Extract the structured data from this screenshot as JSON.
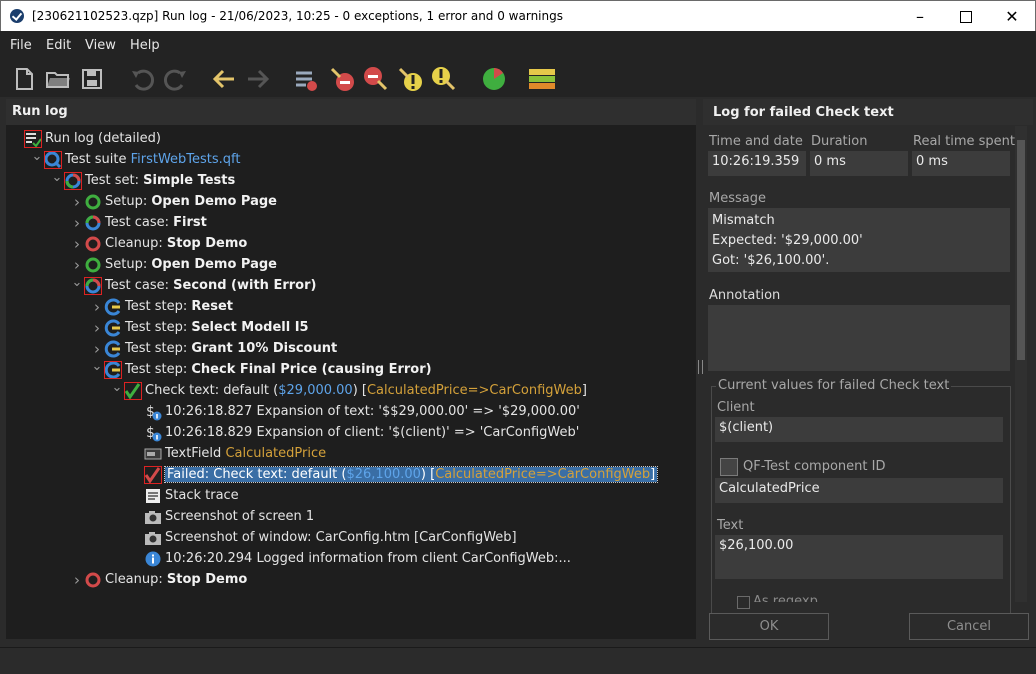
{
  "window": {
    "title": "[230621102523.qzp] Run log - 21/06/2023, 10:25 - 0 exceptions, 1 error and 0 warnings"
  },
  "menu": [
    "File",
    "Edit",
    "View",
    "Help"
  ],
  "toolbar": [
    "new-file",
    "open-folder",
    "save",
    "undo",
    "redo",
    "back-arrow",
    "forward-arrow",
    "collapse-errors",
    "prev-error",
    "next-error",
    "prev-warning",
    "next-warning",
    "pie-chart",
    "bar-chart"
  ],
  "left": {
    "header": "Run log",
    "tree": [
      {
        "indent": 0,
        "chev": "",
        "icon": "log",
        "prefix": "Run log (detailed)",
        "bold": "",
        "extra": ""
      },
      {
        "indent": 1,
        "chev": "v",
        "icon": "suite",
        "prefix": "Test suite ",
        "bold": "",
        "blue": "FirstWebTests.qft"
      },
      {
        "indent": 2,
        "chev": "v",
        "icon": "set",
        "prefix": "Test set: ",
        "bold": "Simple Tests"
      },
      {
        "indent": 3,
        "chev": ">",
        "icon": "setup",
        "prefix": "Setup: ",
        "bold": "Open Demo Page"
      },
      {
        "indent": 3,
        "chev": ">",
        "icon": "case",
        "prefix": "Test case: ",
        "bold": "First"
      },
      {
        "indent": 3,
        "chev": ">",
        "icon": "cleanup",
        "prefix": "Cleanup: ",
        "bold": "Stop Demo"
      },
      {
        "indent": 3,
        "chev": ">",
        "icon": "setup",
        "prefix": "Setup: ",
        "bold": "Open Demo Page"
      },
      {
        "indent": 3,
        "chev": "v",
        "icon": "case-err",
        "prefix": "Test case: ",
        "bold": "Second (with Error)"
      },
      {
        "indent": 4,
        "chev": ">",
        "icon": "step",
        "prefix": "Test step: ",
        "bold": "Reset"
      },
      {
        "indent": 4,
        "chev": ">",
        "icon": "step",
        "prefix": "Test step: ",
        "bold": "Select Modell I5"
      },
      {
        "indent": 4,
        "chev": ">",
        "icon": "step",
        "prefix": "Test step: ",
        "bold": "Grant 10% Discount"
      },
      {
        "indent": 4,
        "chev": "v",
        "icon": "step-err",
        "prefix": "Test step: ",
        "bold": "Check Final Price (causing Error)"
      },
      {
        "indent": 5,
        "chev": "v",
        "icon": "check-err",
        "prefix": "Check text: default (",
        "blue": "$29,000.00",
        "mid": ") [",
        "orange": "CalculatedPrice=>CarConfigWeb",
        "suffix": "]"
      },
      {
        "indent": 6,
        "chev": "",
        "icon": "dollar",
        "prefix": "10:26:18.827 Expansion of text: '$$29,000.00' => '$29,000.00'"
      },
      {
        "indent": 6,
        "chev": "",
        "icon": "dollar",
        "prefix": "10:26:18.829 Expansion of client: '$(client)' => 'CarConfigWeb'"
      },
      {
        "indent": 6,
        "chev": "",
        "icon": "textfield",
        "prefix": "TextField ",
        "orange": "CalculatedPrice"
      },
      {
        "indent": 6,
        "chev": "",
        "icon": "failed",
        "prefix": "Failed: Check text: default (",
        "blue": "$26,100.00",
        "mid": ") [",
        "orange": "CalculatedPrice=>CarConfigWeb",
        "suffix": "]",
        "selected": true
      },
      {
        "indent": 6,
        "chev": "",
        "icon": "stack",
        "prefix": "Stack trace"
      },
      {
        "indent": 6,
        "chev": "",
        "icon": "camera",
        "prefix": "Screenshot of screen 1"
      },
      {
        "indent": 6,
        "chev": "",
        "icon": "camera",
        "prefix": "Screenshot of window: CarConfig.htm [CarConfigWeb]"
      },
      {
        "indent": 6,
        "chev": "",
        "icon": "info",
        "prefix": "10:26:20.294 Logged information from client CarConfigWeb:..."
      },
      {
        "indent": 3,
        "chev": ">",
        "icon": "cleanup",
        "prefix": "Cleanup: ",
        "bold": "Stop Demo"
      }
    ]
  },
  "right": {
    "header": "Log for failed Check text",
    "time_label": "Time and date",
    "time_value": "10:26:19.359",
    "duration_label": "Duration",
    "duration_value": "0 ms",
    "realtime_label": "Real time spent",
    "realtime_value": "0 ms",
    "message_label": "Message",
    "message_lines": [
      "Mismatch",
      "Expected: '$29,000.00'",
      "Got: '$26,100.00'."
    ],
    "annotation_label": "Annotation",
    "group_label": "Current values for failed Check text",
    "client_label": "Client",
    "client_value": "$(client)",
    "component_label": "QF-Test component ID",
    "component_value": "CalculatedPrice",
    "text_label": "Text",
    "text_value": "$26,100.00",
    "regex_label": "As regexp",
    "ok_label": "OK",
    "cancel_label": "Cancel"
  }
}
